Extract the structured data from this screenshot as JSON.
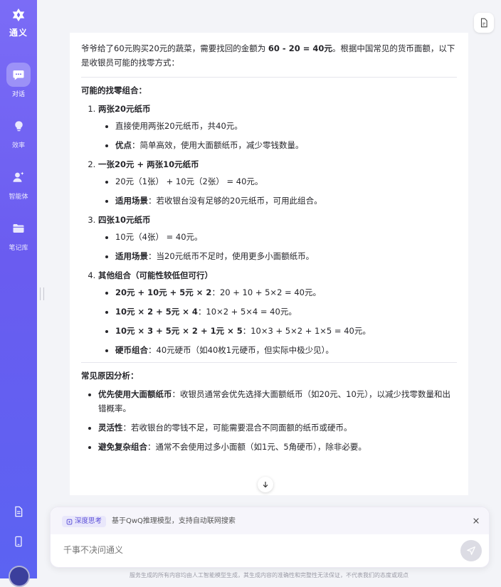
{
  "app": {
    "name": "通义"
  },
  "sidebar": {
    "items": [
      {
        "label": "对话",
        "icon": "chat-icon",
        "active": true
      },
      {
        "label": "效率",
        "icon": "lightbulb-icon",
        "active": false
      },
      {
        "label": "智能体",
        "icon": "agent-icon",
        "active": false
      },
      {
        "label": "笔记库",
        "icon": "folder-icon",
        "active": false
      }
    ]
  },
  "answer": {
    "intro_pre": "爷爷给了60元购买20元的蔬菜，需要找回的金额为 ",
    "intro_bold": "60 - 20 = 40元",
    "intro_post": "。根据中国常见的货币面额，以下是收银员可能的找零方式：",
    "combos_title": "可能的找零组合：",
    "options": [
      {
        "title": "两张20元纸币",
        "points": [
          {
            "label": "",
            "text": "直接使用两张20元纸币，共40元。"
          },
          {
            "label": "优点",
            "text": "：简单高效，使用大面额纸币，减少零钱数量。"
          }
        ]
      },
      {
        "title": "一张20元 + 两张10元纸币",
        "points": [
          {
            "label": "",
            "text": "20元（1张） + 10元（2张） = 40元。"
          },
          {
            "label": "适用场景",
            "text": "：若收银台没有足够的20元纸币，可用此组合。"
          }
        ]
      },
      {
        "title": "四张10元纸币",
        "points": [
          {
            "label": "",
            "text": "10元（4张） = 40元。"
          },
          {
            "label": "适用场景",
            "text": "：当20元纸币不足时，使用更多小面额纸币。"
          }
        ]
      },
      {
        "title": "其他组合（可能性较低但可行）",
        "points": [
          {
            "label": "20元 + 10元 + 5元 × 2",
            "text": "：20 + 10 + 5×2 = 40元。"
          },
          {
            "label": "10元 × 2 + 5元 × 4",
            "text": "：10×2 + 5×4 = 40元。"
          },
          {
            "label": "10元 × 3 + 5元 × 2 + 1元 × 5",
            "text": "：10×3 + 5×2 + 1×5 = 40元。"
          },
          {
            "label": "硬币组合",
            "text": "：40元硬币（如40枚1元硬币，但实际中极少见）。"
          }
        ]
      }
    ],
    "reasons_title": "常见原因分析：",
    "reasons": [
      {
        "label": "优先使用大面额纸币",
        "text": "：收银员通常会优先选择大面额纸币（如20元、10元），以减少找零数量和出错概率。"
      },
      {
        "label": "灵活性",
        "text": "：若收银台的零钱不足，可能需要混合不同面额的纸币或硬币。"
      },
      {
        "label": "避免复杂组合",
        "text": "：通常不会使用过多小面额（如1元、5角硬币），除非必要。"
      }
    ]
  },
  "composer": {
    "deep_think_label": "深度思考",
    "deep_think_desc": "基于QwQ推理模型，支持自动联网搜索",
    "placeholder": "千事不决问通义"
  },
  "disclaimer": "服务生成的所有内容均由人工智能模型生成，其生成内容的准确性和完整性无法保证，不代表我们的态度或观点"
}
